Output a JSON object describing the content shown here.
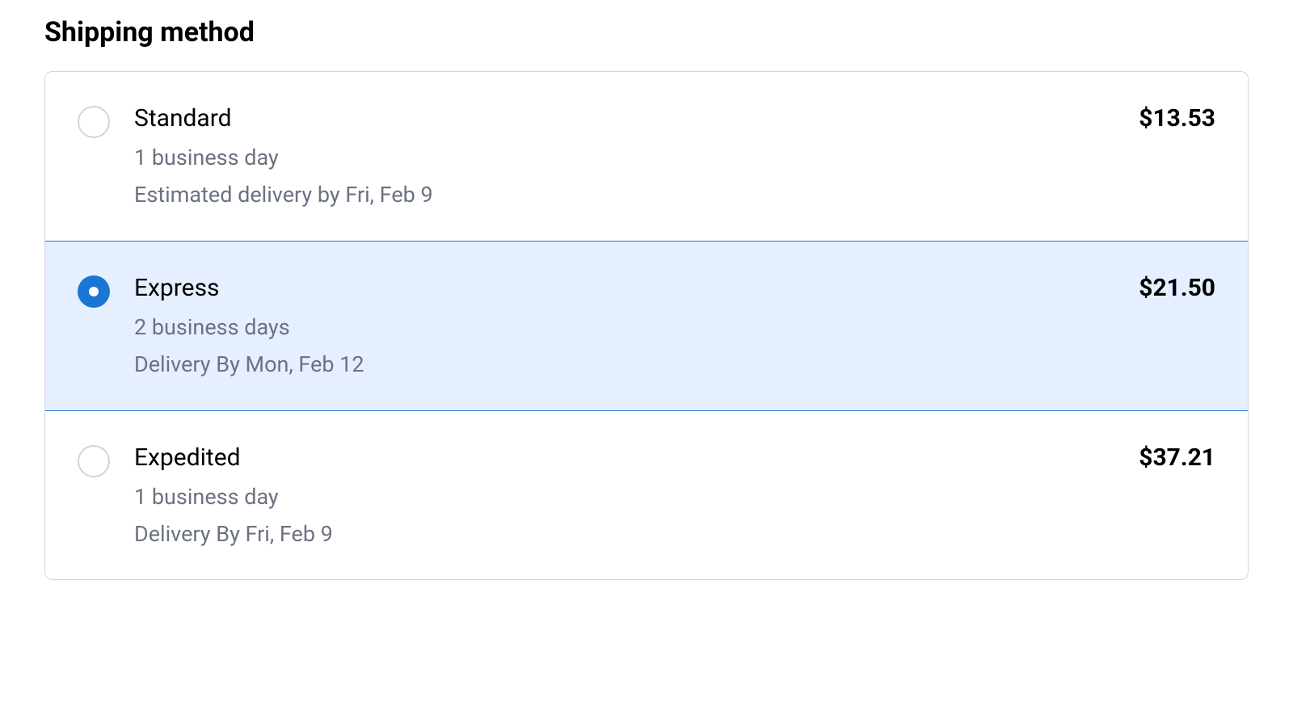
{
  "section": {
    "title": "Shipping method"
  },
  "options": [
    {
      "name": "Standard",
      "duration": "1 business day",
      "delivery": "Estimated delivery by Fri, Feb 9",
      "price": "$13.53",
      "selected": false
    },
    {
      "name": "Express",
      "duration": "2 business days",
      "delivery": "Delivery By Mon, Feb 12",
      "price": "$21.50",
      "selected": true
    },
    {
      "name": "Expedited",
      "duration": "1 business day",
      "delivery": "Delivery By Fri, Feb 9",
      "price": "$37.21",
      "selected": false
    }
  ]
}
